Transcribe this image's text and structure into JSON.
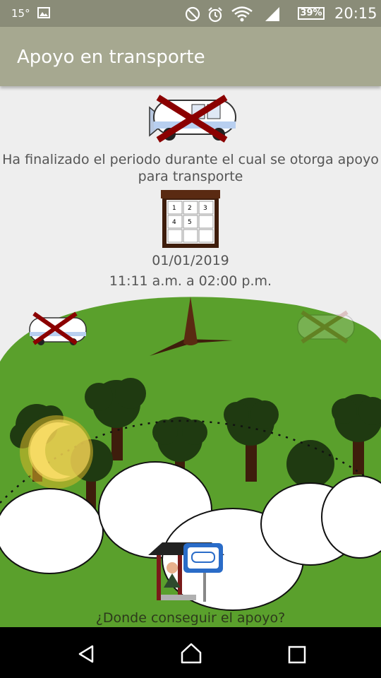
{
  "status_bar": {
    "temperature": "15°",
    "battery": "39%",
    "time": "20:15",
    "icons": [
      "image-icon",
      "do-not-disturb-icon",
      "alarm-icon",
      "wifi-icon",
      "signal-icon",
      "battery-icon"
    ]
  },
  "app_bar": {
    "title": "Apoyo en transporte"
  },
  "main": {
    "message": "Ha finalizado el periodo durante el cual se otorga apoyo para transporte",
    "calendar_days": [
      "1",
      "2",
      "3",
      "4",
      "5"
    ],
    "date": "01/01/2019",
    "time_range": "11:11 a.m. a 02:00 p.m.",
    "where_link": "¿Donde conseguir el apoyo?"
  },
  "colors": {
    "status_bar": "#8a8c78",
    "app_bar": "#a6a890",
    "grass": "#5aa02c",
    "tree": "#1f3a11",
    "cross": "#8b0000"
  },
  "nav_bar": {
    "icons": [
      "back-icon",
      "home-icon",
      "recents-icon"
    ]
  }
}
